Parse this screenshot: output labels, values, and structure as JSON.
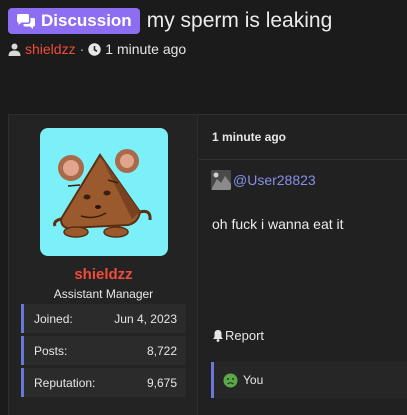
{
  "thread": {
    "badge_label": "Discussion",
    "title": "my sperm is leaking",
    "author": "shieldzz",
    "separator": "·",
    "time": "1 minute ago"
  },
  "post": {
    "user": {
      "name": "shieldzz",
      "role": "Assistant Manager",
      "stats": [
        {
          "label": "Joined:",
          "value": "Jun 4, 2023"
        },
        {
          "label": "Posts:",
          "value": "8,722"
        },
        {
          "label": "Reputation:",
          "value": "9,675"
        }
      ]
    },
    "time": "1 minute ago",
    "quote_user": "@User28823",
    "message": "oh fuck i wanna eat it",
    "report_label": "Report",
    "reaction_label": "You"
  },
  "colors": {
    "accent_purple": "#8d6ef2",
    "username_red": "#f04b3b",
    "link_blue": "#8590e8",
    "stat_border": "#6a78d9",
    "avatar_bg": "#7bf0f8"
  }
}
